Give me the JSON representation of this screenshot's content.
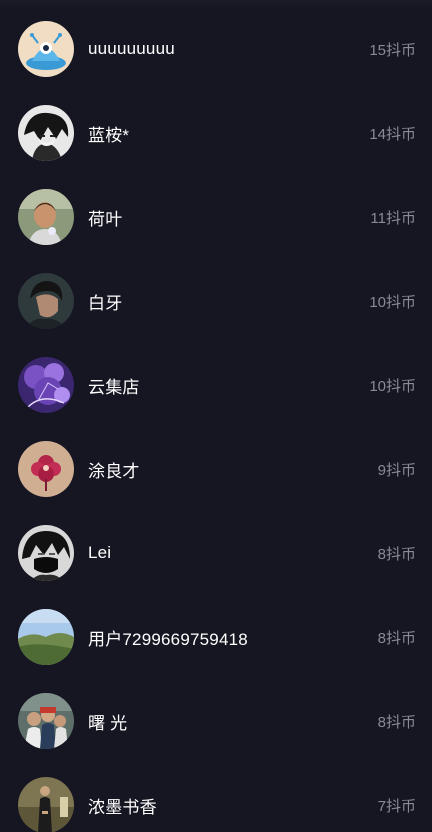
{
  "users": [
    {
      "name": "uuuuuuuuu",
      "coins": "15抖币",
      "avatar": "alien-cartoon-avatar"
    },
    {
      "name": "蓝桉*",
      "coins": "14抖币",
      "avatar": "anime-boy-avatar"
    },
    {
      "name": "荷叶",
      "coins": "11抖币",
      "avatar": "boy-photo-avatar"
    },
    {
      "name": "白牙",
      "coins": "10抖币",
      "avatar": "man-portrait-avatar"
    },
    {
      "name": "云集店",
      "coins": "10抖币",
      "avatar": "purple-blossom-avatar"
    },
    {
      "name": "涂良才",
      "coins": "9抖币",
      "avatar": "flower-logo-avatar"
    },
    {
      "name": "Lei",
      "coins": "8抖币",
      "avatar": "masked-anime-avatar"
    },
    {
      "name": "用户7299669759418",
      "coins": "8抖币",
      "avatar": "landscape-avatar"
    },
    {
      "name": "曙 光",
      "coins": "8抖币",
      "avatar": "group-photo-avatar"
    },
    {
      "name": "浓墨书香",
      "coins": "7抖币",
      "avatar": "robed-man-avatar"
    }
  ]
}
